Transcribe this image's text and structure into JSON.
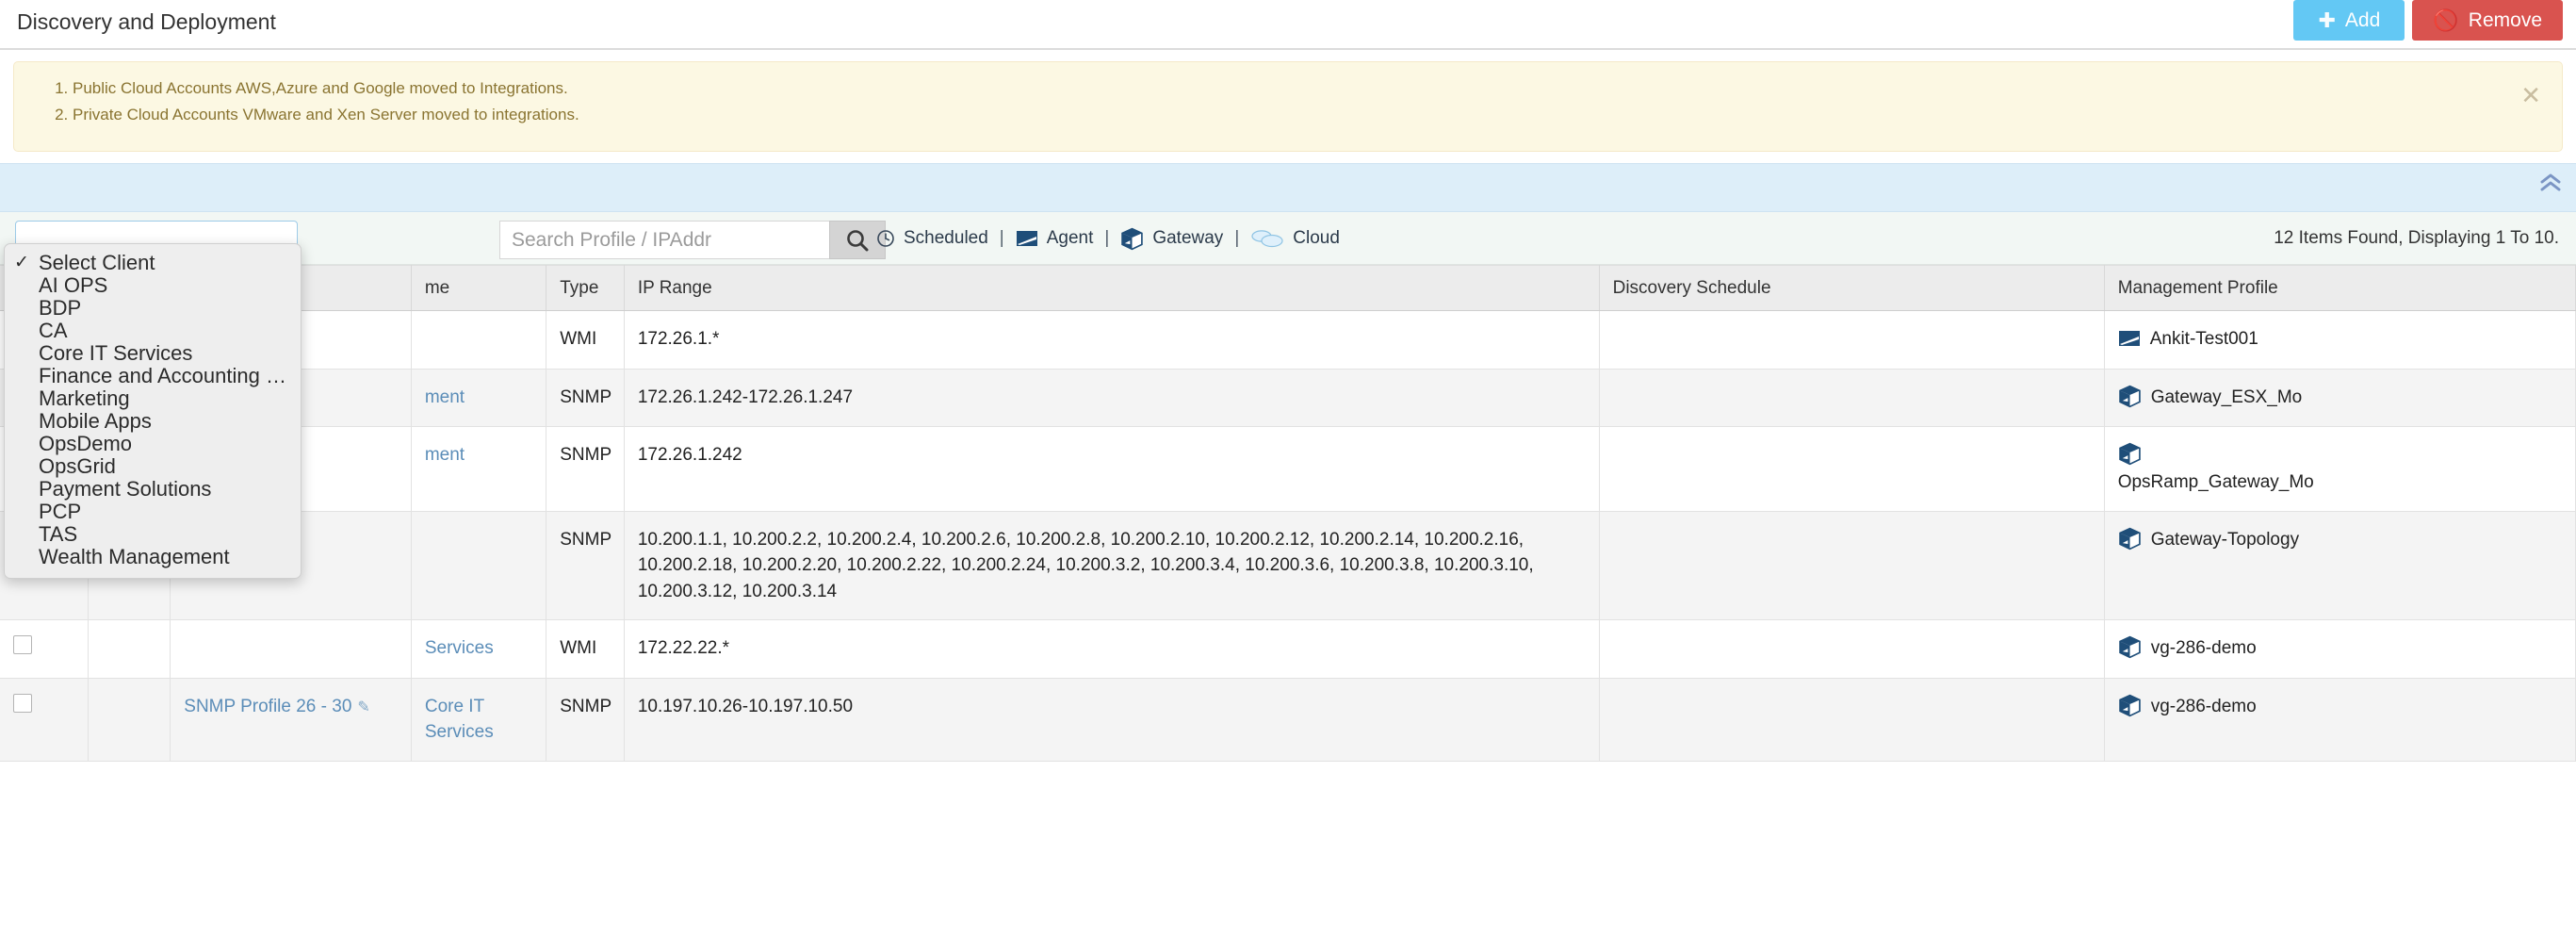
{
  "header": {
    "title": "Discovery and Deployment",
    "add_label": "Add",
    "add_icon": "plus-icon",
    "remove_label": "Remove",
    "remove_icon": "no-entry-icon",
    "add_color": "#63c8f4",
    "remove_color": "#d9534f"
  },
  "notice": {
    "items": [
      "Public Cloud Accounts AWS,Azure and Google moved to Integrations.",
      "Private Cloud Accounts VMware and Xen Server moved to integrations."
    ],
    "close_icon": "close-icon",
    "background": "#fcf8e3",
    "text_color": "#8a7431"
  },
  "filter_bar": {
    "collapse_icon": "chevron-double-up-icon",
    "background": "#ddeef9"
  },
  "toolbar": {
    "client_select_value": "Select Client",
    "search_placeholder": "Search Profile / IPAddr",
    "search_value": "",
    "search_icon": "search-icon",
    "legend": [
      {
        "label": "Scheduled",
        "icon": "clock-icon"
      },
      {
        "label": "Agent",
        "icon": "agent-icon"
      },
      {
        "label": "Gateway",
        "icon": "gateway-cube-icon"
      },
      {
        "label": "Cloud",
        "icon": "cloud-icon"
      }
    ],
    "items_found": "12 Items Found, Displaying 1 To 10."
  },
  "dropdown": {
    "open": true,
    "selected": "Select Client",
    "items": [
      "Select Client",
      "AI OPS",
      "BDP",
      "CA",
      "Core IT Services",
      "Finance and Accounting Service...",
      "Marketing",
      "Mobile Apps",
      "OpsDemo",
      "OpsGrid",
      "Payment Solutions",
      "PCP",
      "TAS",
      "Wealth Management"
    ],
    "check_glyph": "✓"
  },
  "table": {
    "columns": [
      {
        "key": "chk",
        "label": ""
      },
      {
        "key": "star",
        "label": ""
      },
      {
        "key": "name",
        "label": ""
      },
      {
        "key": "client",
        "label": ""
      },
      {
        "key": "type",
        "label": "Type"
      },
      {
        "key": "ip",
        "label": "IP Range"
      },
      {
        "key": "sched",
        "label": "Discovery Schedule"
      },
      {
        "key": "mgmt",
        "label": "Management Profile"
      }
    ],
    "header_name_partial": "me",
    "rows": [
      {
        "name": "",
        "client": "",
        "type": "WMI",
        "ip": "172.26.1.*",
        "schedule": "",
        "mgmt_label": "Ankit-Test001",
        "mgmt_icon": "agent-icon"
      },
      {
        "name": "",
        "client": "ment",
        "type": "SNMP",
        "ip": "172.26.1.242-172.26.1.247",
        "schedule": "",
        "mgmt_label": "Gateway_ESX_Mo",
        "mgmt_icon": "gateway-cube-icon"
      },
      {
        "name": "",
        "client": "ment",
        "type": "SNMP",
        "ip": "172.26.1.242",
        "schedule": "",
        "mgmt_label": "OpsRamp_Gateway_Mo",
        "mgmt_icon": "gateway-cube-icon"
      },
      {
        "name": "",
        "client": "",
        "type": "SNMP",
        "ip": "10.200.1.1, 10.200.2.2, 10.200.2.4, 10.200.2.6, 10.200.2.8, 10.200.2.10, 10.200.2.12, 10.200.2.14, 10.200.2.16, 10.200.2.18, 10.200.2.20, 10.200.2.22, 10.200.2.24, 10.200.3.2, 10.200.3.4, 10.200.3.6, 10.200.3.8, 10.200.3.10, 10.200.3.12, 10.200.3.14",
        "schedule": "",
        "mgmt_label": "Gateway-Topology",
        "mgmt_icon": "gateway-cube-icon"
      },
      {
        "name": "",
        "client": "Services",
        "type": "WMI",
        "ip": "172.22.22.*",
        "schedule": "",
        "mgmt_label": "vg-286-demo",
        "mgmt_icon": "gateway-cube-icon"
      },
      {
        "name": "SNMP Profile 26 - 30",
        "client": "Core IT Services",
        "type": "SNMP",
        "ip": "10.197.10.26-10.197.10.50",
        "schedule": "",
        "mgmt_label": "vg-286-demo",
        "mgmt_icon": "gateway-cube-icon"
      }
    ],
    "edit_icon": "edit-pencil-icon",
    "checkbox": "row-checkbox"
  }
}
